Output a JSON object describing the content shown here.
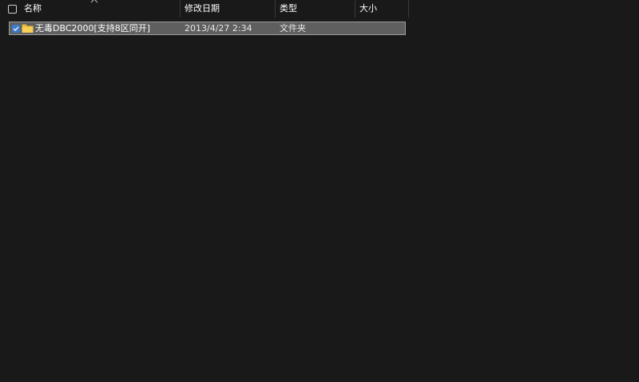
{
  "columns": {
    "name": "名称",
    "date": "修改日期",
    "type": "类型",
    "size": "大小"
  },
  "sort": {
    "column": "name",
    "direction": "ascending"
  },
  "rows": [
    {
      "name": "无毒DBC2000[支持8区同开]",
      "date": "2013/4/27 2:34",
      "type": "文件夹",
      "size": "",
      "selected": true,
      "checked": true,
      "icon": "folder-icon"
    }
  ],
  "colors": {
    "background": "#191919",
    "selection": "#5f5f5f",
    "checkbox_accent": "#3c7cc8",
    "folder": "#f3c542"
  }
}
